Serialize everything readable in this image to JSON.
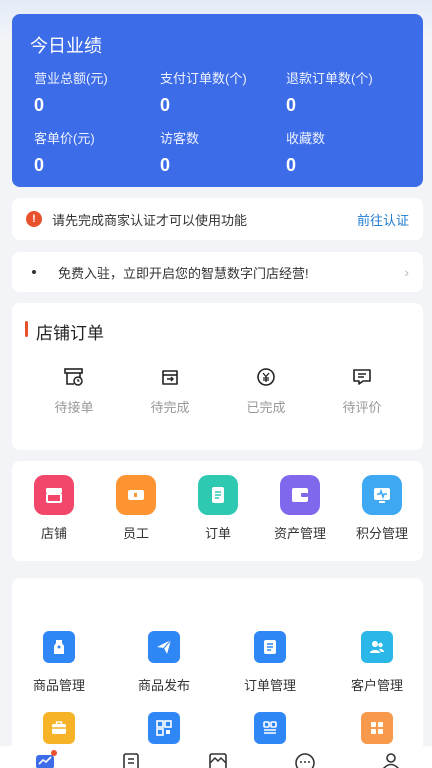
{
  "performance": {
    "title": "今日业绩",
    "stats": [
      {
        "label": "营业总额(元)",
        "value": "0"
      },
      {
        "label": "支付订单数(个)",
        "value": "0"
      },
      {
        "label": "退款订单数(个)",
        "value": "0"
      },
      {
        "label": "客单价(元)",
        "value": "0"
      },
      {
        "label": "访客数",
        "value": "0"
      },
      {
        "label": "收藏数",
        "value": "0"
      }
    ]
  },
  "notice": {
    "icon": "warning-icon",
    "icon_glyph": "!",
    "text": "请先完成商家认证才可以使用功能",
    "link": "前往认证"
  },
  "banner": {
    "text": "免费入驻，立即开启您的智慧数字门店经营!",
    "chevron": "›"
  },
  "orders": {
    "title": "店铺订单",
    "items": [
      {
        "label": "待接单",
        "icon": "pending-accept-icon"
      },
      {
        "label": "待完成",
        "icon": "pending-complete-icon"
      },
      {
        "label": "已完成",
        "icon": "completed-icon"
      },
      {
        "label": "待评价",
        "icon": "pending-review-icon"
      }
    ]
  },
  "tools": [
    {
      "label": "店铺",
      "icon": "store-icon",
      "color": "#f2476a"
    },
    {
      "label": "员工",
      "icon": "staff-icon",
      "color": "#fb9431"
    },
    {
      "label": "订单",
      "icon": "order-icon",
      "color": "#2ec9b0"
    },
    {
      "label": "资产管理",
      "icon": "wallet-icon",
      "color": "#8167ec"
    },
    {
      "label": "积分管理",
      "icon": "points-icon",
      "color": "#3ea8f3"
    }
  ],
  "management": [
    {
      "label": "商品管理",
      "icon": "product-tag-icon",
      "color": "#2f86f5"
    },
    {
      "label": "商品发布",
      "icon": "publish-plane-icon",
      "color": "#2f86f5"
    },
    {
      "label": "订单管理",
      "icon": "order-list-icon",
      "color": "#2f86f5"
    },
    {
      "label": "客户管理",
      "icon": "customers-icon",
      "color": "#2bb8e8"
    },
    {
      "label": "",
      "icon": "briefcase-icon",
      "color": "#f7b328"
    },
    {
      "label": "",
      "icon": "qrcode-icon",
      "color": "#2f86f5"
    },
    {
      "label": "",
      "icon": "scan-icon",
      "color": "#2f86f5"
    },
    {
      "label": "",
      "icon": "apps-grid-icon",
      "color": "#f89a4c"
    }
  ],
  "tabbar": [
    {
      "icon": "chart-trend-icon",
      "badge": true
    },
    {
      "icon": "document-icon"
    },
    {
      "icon": "image-icon"
    },
    {
      "icon": "message-icon"
    },
    {
      "icon": "user-icon"
    }
  ],
  "colors": {
    "primary": "#3d6ce9",
    "accent": "#e9512c",
    "link": "#1e7bd0"
  }
}
